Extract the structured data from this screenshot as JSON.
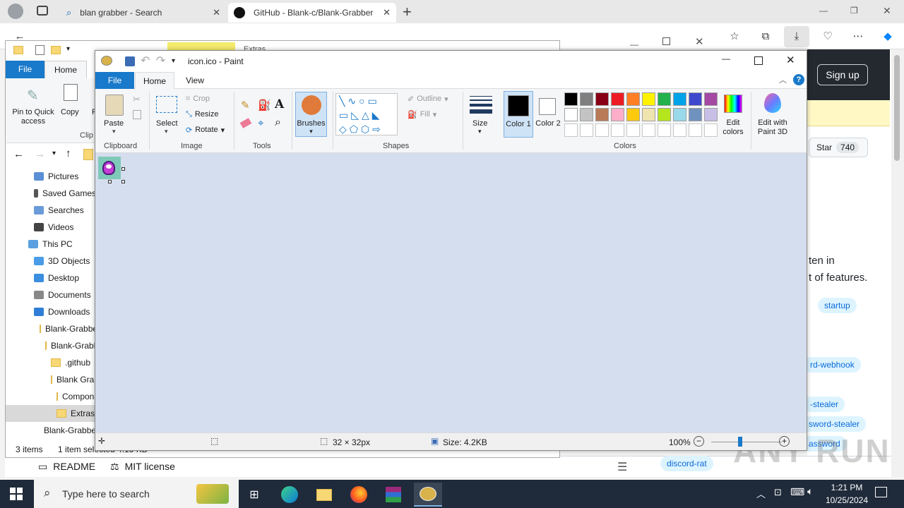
{
  "browser": {
    "tabs": [
      {
        "label": "blan grabber - Search"
      },
      {
        "label": "GitHub - Blank-c/Blank-Grabber"
      }
    ],
    "new_tab": "+",
    "window_buttons": [
      "—",
      "❐",
      "✕"
    ]
  },
  "github": {
    "sign_up": "Sign up",
    "star_label": "Star",
    "star_count": "740",
    "about_line1": "ten in",
    "about_line2": "t of features.",
    "topics": [
      "startup",
      "rd-webhook",
      "-stealer",
      "sword-stealer",
      "assword",
      "discord-rat"
    ],
    "readme_tab": "README",
    "license_tab": "MIT license",
    "watermark": "ANY RUN"
  },
  "explorer": {
    "title_fragment": "Extras",
    "tabs": {
      "file": "File",
      "home": "Home"
    },
    "ribbon": {
      "pin": "Pin to Quick access",
      "copy": "Copy",
      "paste_partial": "P",
      "group": "Clip"
    },
    "tree": [
      {
        "label": "Pictures",
        "icon": "pictures-icon"
      },
      {
        "label": "Saved Games",
        "icon": "saved-games-icon"
      },
      {
        "label": "Searches",
        "icon": "search-icon"
      },
      {
        "label": "Videos",
        "icon": "videos-icon"
      },
      {
        "label": "This PC",
        "icon": "pc-icon"
      },
      {
        "label": "3D Objects",
        "icon": "3d-objects-icon"
      },
      {
        "label": "Desktop",
        "icon": "desktop-icon"
      },
      {
        "label": "Documents",
        "icon": "documents-icon"
      },
      {
        "label": "Downloads",
        "icon": "downloads-icon"
      },
      {
        "label": "Blank-Grabber-main",
        "icon": "folder-icon"
      },
      {
        "label": "Blank-Grabber-main",
        "icon": "folder-icon"
      },
      {
        "label": ".github",
        "icon": "folder-icon"
      },
      {
        "label": "Blank Grabber",
        "icon": "folder-icon"
      },
      {
        "label": "Components",
        "icon": "folder-icon"
      },
      {
        "label": "Extras",
        "icon": "folder-icon"
      },
      {
        "label": "Blank-Grabber-main.zip",
        "icon": "winrar-icon"
      }
    ],
    "status_items": "3 items",
    "status_selected": "1 item selected  4.15 KB"
  },
  "paint": {
    "title": "icon.ico - Paint",
    "tabs": {
      "file": "File",
      "home": "Home",
      "view": "View"
    },
    "clipboard": {
      "paste": "Paste",
      "group": "Clipboard"
    },
    "image": {
      "select": "Select",
      "crop": "Crop",
      "resize": "Resize",
      "rotate": "Rotate",
      "group": "Image"
    },
    "tools": {
      "group": "Tools"
    },
    "brushes": "Brushes",
    "shapes": {
      "outline": "Outline",
      "fill": "Fill",
      "group": "Shapes"
    },
    "size": "Size",
    "color1": "Color 1",
    "color2": "Color 2",
    "colors_group": "Colors",
    "edit_colors": "Edit colors",
    "edit_paint3d": "Edit with Paint 3D",
    "palette": [
      "#000000",
      "#7f7f7f",
      "#880015",
      "#ed1c24",
      "#ff7f27",
      "#fff200",
      "#22b14c",
      "#00a2e8",
      "#3f48cc",
      "#a349a4",
      "#ffffff",
      "#c3c3c3",
      "#b97a57",
      "#ffaec9",
      "#ffc90e",
      "#efe4b0",
      "#b5e61d",
      "#99d9ea",
      "#7092be",
      "#c8bfe7"
    ],
    "status": {
      "dimensions": "32 × 32px",
      "size": "Size: 4.2KB",
      "zoom": "100%"
    }
  },
  "taskbar": {
    "search_placeholder": "Type here to search",
    "time": "1:21 PM",
    "date": "10/25/2024"
  }
}
